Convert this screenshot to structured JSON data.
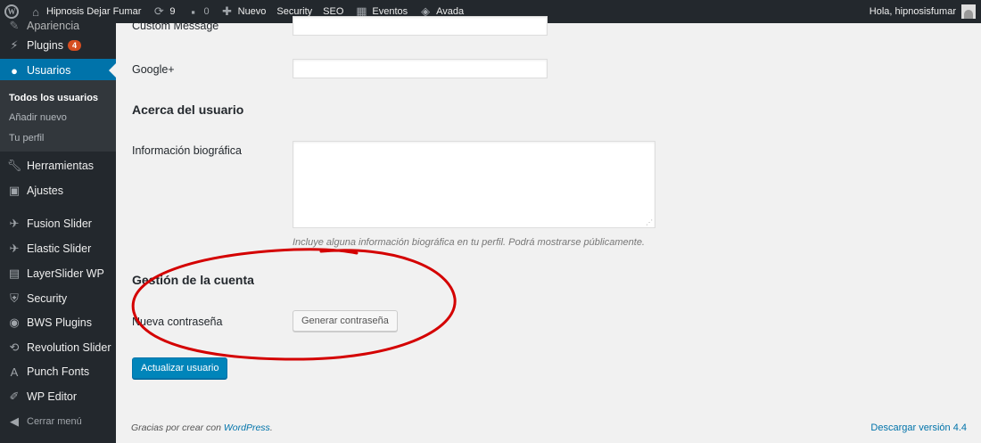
{
  "admin_bar": {
    "site_name": "Hipnosis Dejar Fumar",
    "updates_count": "9",
    "comments_count": "0",
    "new_label": "Nuevo",
    "security_label": "Security",
    "seo_label": "SEO",
    "events_label": "Eventos",
    "avada_label": "Avada",
    "greeting": "Hola, hipnosisfumar"
  },
  "sidebar": {
    "partial_top_label": "Apariencia",
    "plugins_label": "Plugins",
    "plugins_badge": "4",
    "users_label": "Usuarios",
    "submenu": {
      "all_users": "Todos los usuarios",
      "add_new": "Añadir nuevo",
      "profile": "Tu perfil"
    },
    "tools_label": "Herramientas",
    "settings_label": "Ajustes",
    "fusion_slider": "Fusion Slider",
    "elastic_slider": "Elastic Slider",
    "layerslider": "LayerSlider WP",
    "security": "Security",
    "bws_plugins": "BWS Plugins",
    "revolution_slider": "Revolution Slider",
    "punch_fonts": "Punch Fonts",
    "wp_editor": "WP Editor",
    "collapse_menu": "Cerrar menú"
  },
  "form": {
    "custom_message_label": "Custom Message",
    "custom_message_value": "",
    "googleplus_label": "Google+",
    "googleplus_value": "",
    "about_heading": "Acerca del usuario",
    "bio_label": "Información biográfica",
    "bio_value": "",
    "bio_description": "Incluye alguna información biográfica en tu perfil. Podrá mostrarse públicamente.",
    "account_heading": "Gestión de la cuenta",
    "new_password_label": "Nueva contraseña",
    "generate_password_button": "Generar contraseña",
    "update_button": "Actualizar usuario"
  },
  "footer": {
    "thanks_text": "Gracias por crear con ",
    "wordpress_link": "WordPress",
    "thanks_suffix": ".",
    "version_link": "Descargar versión 4.4"
  },
  "colors": {
    "sidebar_bg": "#23282d",
    "accent": "#0073aa",
    "primary_button": "#0085ba",
    "annotation_ellipse": "#d40000",
    "badge": "#d54e21"
  }
}
